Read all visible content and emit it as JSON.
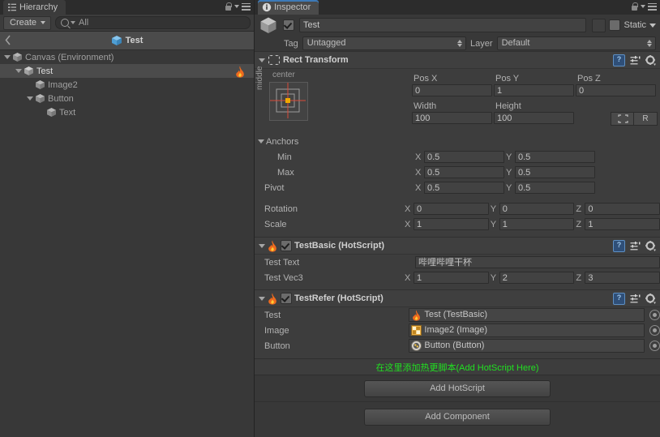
{
  "hierarchy": {
    "tab_label": "Hierarchy",
    "tab_icon": "hierarchy-icon",
    "create_label": "Create",
    "search_placeholder": "All",
    "search_value": "All",
    "breadcrumb_label": "Test",
    "tree": [
      {
        "label": "Canvas (Environment)",
        "depth": 0,
        "expanded": true,
        "selected": false,
        "flame": false
      },
      {
        "label": "Test",
        "depth": 1,
        "expanded": true,
        "selected": true,
        "flame": true
      },
      {
        "label": "Image2",
        "depth": 2,
        "expanded": false,
        "selected": false,
        "flame": false
      },
      {
        "label": "Button",
        "depth": 2,
        "expanded": true,
        "selected": false,
        "flame": false
      },
      {
        "label": "Text",
        "depth": 3,
        "expanded": false,
        "selected": false,
        "flame": false
      }
    ]
  },
  "inspector": {
    "tab_label": "Inspector",
    "object": {
      "enabled": true,
      "name": "Test",
      "static_label": "Static",
      "static_checked": false,
      "tag_label": "Tag",
      "tag_value": "Untagged",
      "layer_label": "Layer",
      "layer_value": "Default"
    },
    "rect_transform": {
      "title": "Rect Transform",
      "anchor_preset_h": "center",
      "anchor_preset_v": "middle",
      "pos_headers": [
        "Pos X",
        "Pos Y",
        "Pos Z"
      ],
      "pos_values": [
        "0",
        "1",
        "0"
      ],
      "size_headers": [
        "Width",
        "Height"
      ],
      "size_values": [
        "100",
        "100"
      ],
      "blueprint_label": "",
      "raw_label": "R",
      "anchors_label": "Anchors",
      "min_label": "Min",
      "min": {
        "x": "0.5",
        "y": "0.5"
      },
      "max_label": "Max",
      "max": {
        "x": "0.5",
        "y": "0.5"
      },
      "pivot_label": "Pivot",
      "pivot": {
        "x": "0.5",
        "y": "0.5"
      },
      "rotation_label": "Rotation",
      "rotation": {
        "x": "0",
        "y": "0",
        "z": "0"
      },
      "scale_label": "Scale",
      "scale": {
        "x": "1",
        "y": "1",
        "z": "1"
      }
    },
    "test_basic": {
      "title": "TestBasic (HotScript)",
      "enabled": true,
      "text_label": "Test Text",
      "text_value": "哔哩哔哩干杯",
      "vec_label": "Test Vec3",
      "vec": {
        "x": "1",
        "y": "2",
        "z": "3"
      }
    },
    "test_refer": {
      "title": "TestRefer (HotScript)",
      "enabled": true,
      "fields": [
        {
          "label": "Test",
          "value": "Test (TestBasic)",
          "icon": "flame-icon"
        },
        {
          "label": "Image",
          "value": "Image2 (Image)",
          "icon": "image-icon"
        },
        {
          "label": "Button",
          "value": "Button (Button)",
          "icon": "button-icon"
        }
      ]
    },
    "hot_hint": {
      "text": "在这里添加热更脚本(Add HotScript Here)",
      "color": "#21e021"
    },
    "add_hotscript_label": "Add HotScript",
    "add_component_label": "Add Component"
  },
  "axes": {
    "x": "X",
    "y": "Y",
    "z": "Z"
  },
  "colors": {
    "background": "#383838",
    "panel": "#3d3d3d",
    "accent_blue": "#3d7ab8",
    "flame_orange": "#e8631a",
    "hint_green": "#21e021"
  }
}
